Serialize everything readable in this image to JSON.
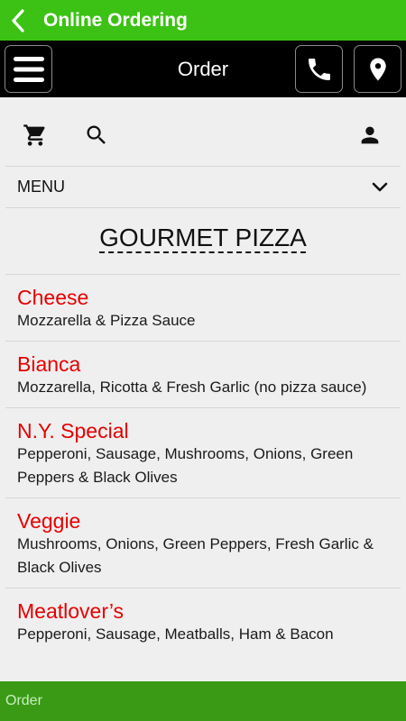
{
  "appbar": {
    "title": "Online Ordering"
  },
  "header": {
    "title": "Order"
  },
  "menu_select": {
    "label": "MENU"
  },
  "section": {
    "title": "GOURMET PIZZA"
  },
  "items": [
    {
      "name": "Cheese",
      "desc": "Mozzarella & Pizza Sauce"
    },
    {
      "name": "Bianca",
      "desc": "Mozzarella, Ricotta & Fresh Garlic (no pizza sauce)"
    },
    {
      "name": "N.Y. Special",
      "desc": "Pepperoni, Sausage, Mushrooms, Onions, Green Peppers & Black Olives"
    },
    {
      "name": "Veggie",
      "desc": "Mushrooms, Onions, Green Peppers, Fresh Garlic & Black Olives"
    },
    {
      "name": "Meatlover’s",
      "desc": "Pepperoni, Sausage, Meatballs, Ham & Bacon"
    }
  ],
  "footer": {
    "label": "Order"
  },
  "colors": {
    "appbar": "#3cc214",
    "header": "#000000",
    "item_name": "#e60000",
    "footer": "#3a9a16"
  },
  "icons": [
    "back-icon",
    "hamburger-icon",
    "phone-icon",
    "location-pin-icon",
    "cart-icon",
    "search-icon",
    "user-icon",
    "chevron-down-icon"
  ]
}
